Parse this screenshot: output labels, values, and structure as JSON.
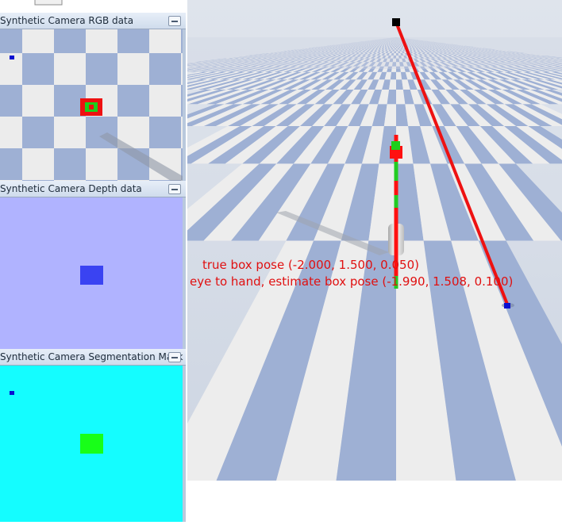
{
  "panels": {
    "rgb": {
      "title": "Synthetic Camera RGB data"
    },
    "depth": {
      "title": "Synthetic Camera Depth data"
    },
    "segmentation": {
      "title": "Synthetic Camera Segmentation Mask"
    }
  },
  "overlay": {
    "true_pose": "true box pose (-2.000, 1.500, 0.050)",
    "estimate_pose": "eye to hand, estimate box pose (-1.990, 1.508, 0.100)"
  },
  "colors": {
    "sky": "#d6dde8",
    "floor_light": "#ededed",
    "floor_blue": "#9eb0d4",
    "depth_bg": "#b0b3ff",
    "depth_box": "#3a43f2",
    "seg_bg": "#14fdff",
    "seg_box": "#18ff18",
    "laser": "#ee1111",
    "text": "#e01010"
  },
  "icons": {
    "close": "minimize-icon"
  }
}
